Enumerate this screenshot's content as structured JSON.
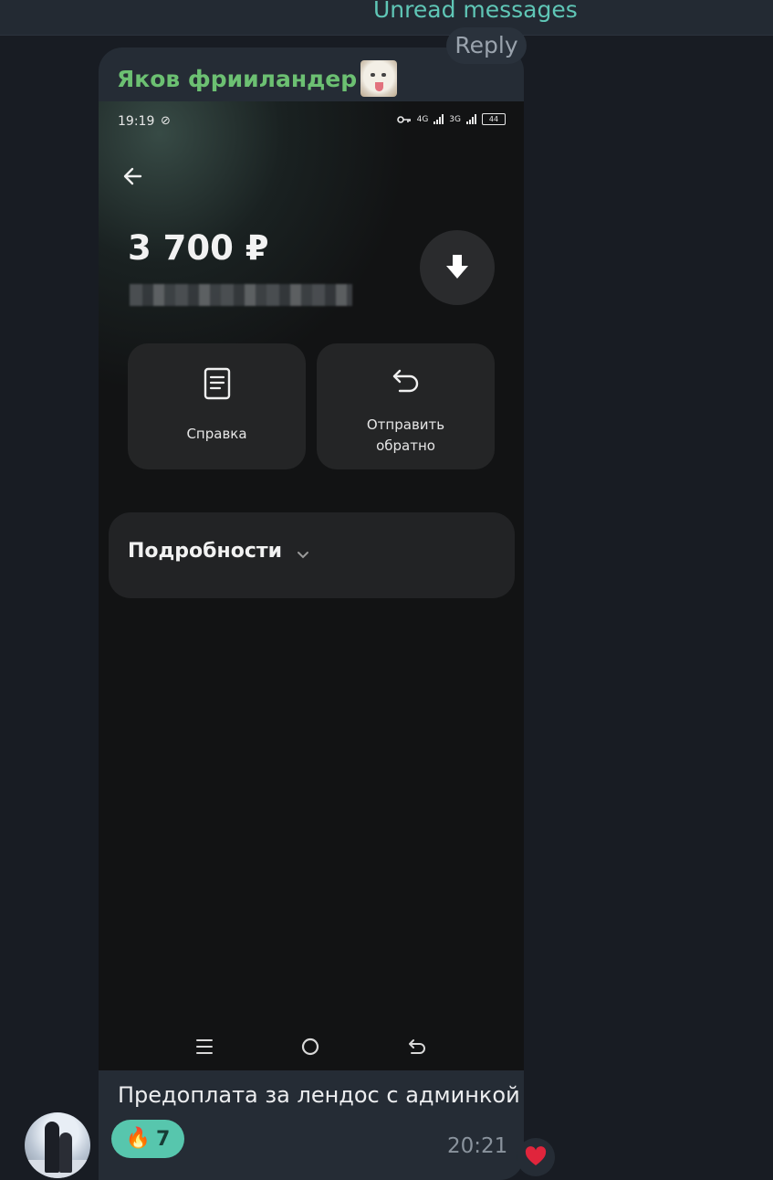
{
  "chat": {
    "unread_label": "Unread messages",
    "reply_label": "Reply"
  },
  "message": {
    "sender_name": "Яков фрииландер",
    "caption": "Предоплата за лендос с админкой",
    "time": "20:21",
    "reaction": {
      "emoji": "🔥",
      "count": "7"
    },
    "own_reaction_icon": "heart-icon",
    "sender_sticker_icon": "cat-face-icon",
    "avatar_icon": "user-avatar"
  },
  "screenshot": {
    "status_bar": {
      "time": "19:19",
      "net1": "4G",
      "net2": "3G",
      "battery": "44"
    },
    "amount": "3 700 ₽",
    "actions": [
      {
        "label": "Справка",
        "icon": "document-icon"
      },
      {
        "label": "Отправить обратно",
        "icon": "return-arrow-icon"
      }
    ],
    "details_label": "Подробности",
    "nav_icons": [
      "menu-icon",
      "home-circle-icon",
      "back-icon"
    ]
  },
  "colors": {
    "background": "#181c23",
    "bubble": "#252c35",
    "sender_name": "#6cc072",
    "unread_accent": "#5fc6b6",
    "reaction_pill": "#57c6ad",
    "heart": "#e0253c"
  }
}
